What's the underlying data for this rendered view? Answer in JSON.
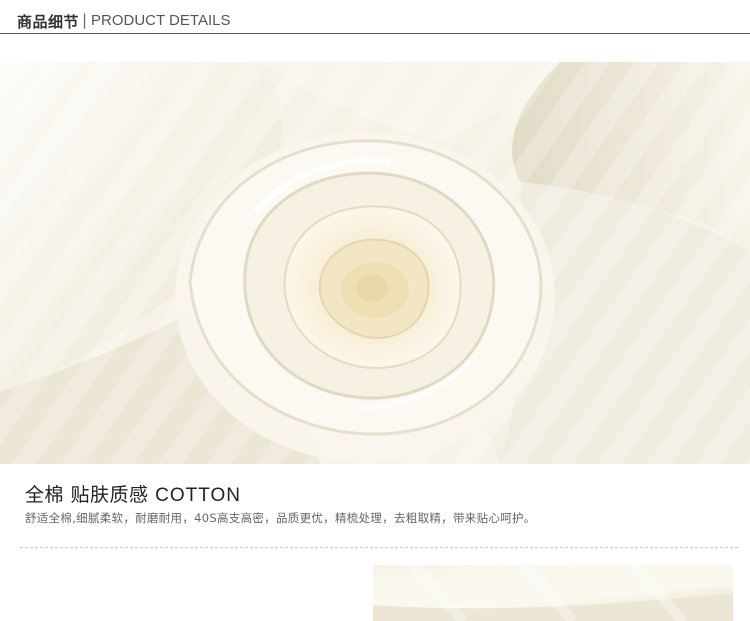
{
  "header": {
    "title_cn": "商品细节",
    "separator": "|",
    "title_en": "PRODUCT DETAILS"
  },
  "feature": {
    "title_cn": "全棉 贴肤质感",
    "title_en": "COTTON",
    "description": "舒适全棉,细腻柔软，耐磨耐用，40S高支高密，品质更优，精梳处理，去粗取精，带来贴心呵护。"
  },
  "images": {
    "main": "cotton-fabric-swirl-photo",
    "secondary": "cotton-fabric-folds-photo"
  },
  "colors": {
    "fabric": "#f4f1e6",
    "fabric_shadow": "#e3dcc8",
    "fabric_warm": "#efe3c4",
    "header_rule": "#555555"
  }
}
